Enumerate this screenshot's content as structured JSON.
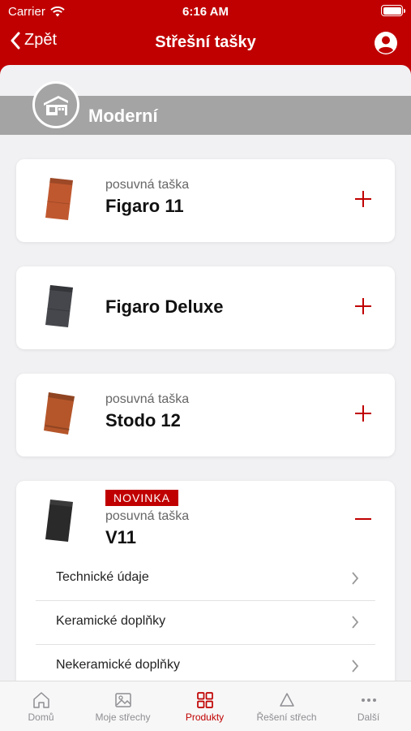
{
  "status_bar": {
    "carrier": "Carrier",
    "time": "6:16 AM"
  },
  "nav": {
    "back_label": "Zpět",
    "title": "Střešní tašky"
  },
  "category": {
    "title": "Moderní"
  },
  "products": [
    {
      "subtitle": "posuvná taška",
      "name": "Figaro 11",
      "color": "#c0582f",
      "expanded": false
    },
    {
      "subtitle": "",
      "name": "Figaro Deluxe",
      "color": "#45474c",
      "expanded": false
    },
    {
      "subtitle": "posuvná taška",
      "name": "Stodo 12",
      "color": "#b5562a",
      "expanded": false
    },
    {
      "badge": "NOVINKA",
      "subtitle": "posuvná taška",
      "name": "V11",
      "color": "#2a2a2a",
      "expanded": true,
      "items": [
        {
          "label": "Technické údaje"
        },
        {
          "label": "Keramické doplňky"
        },
        {
          "label": "Nekeramické doplňky"
        }
      ]
    }
  ],
  "tabs": [
    {
      "label": "Domů",
      "icon": "home-icon",
      "active": false
    },
    {
      "label": "Moje střechy",
      "icon": "image-icon",
      "active": false
    },
    {
      "label": "Produkty",
      "icon": "grid-icon",
      "active": true
    },
    {
      "label": "Řešení střech",
      "icon": "triangle-icon",
      "active": false
    },
    {
      "label": "Další",
      "icon": "more-icon",
      "active": false
    }
  ],
  "colors": {
    "brand_red": "#c00000",
    "header_gray": "#a4a4a4",
    "background": "#f1f1f3"
  }
}
